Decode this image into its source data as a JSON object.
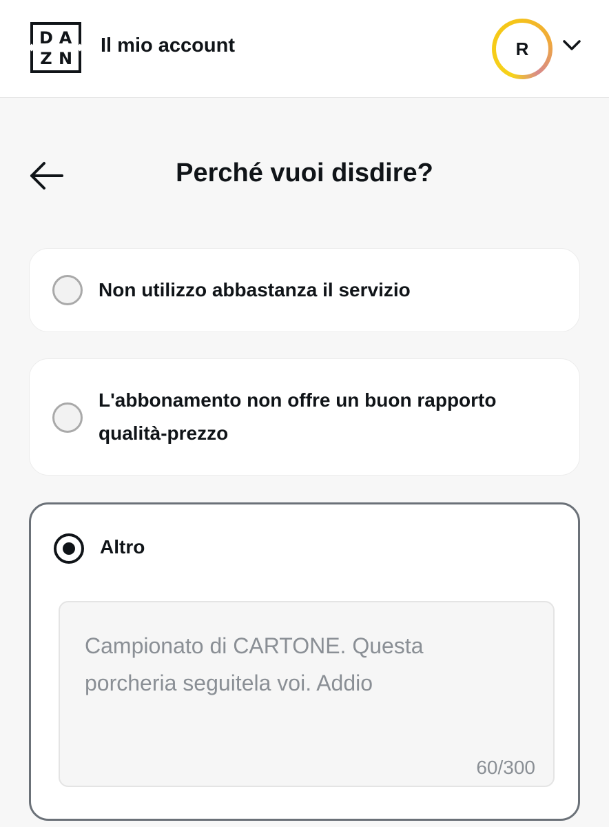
{
  "header": {
    "logo_letters": [
      "D",
      "A",
      "Z",
      "N"
    ],
    "title": "Il mio account",
    "avatar_initial": "R",
    "menu_icon": "chevron-down-icon"
  },
  "page": {
    "back_icon": "arrow-left-icon",
    "title": "Perché vuoi disdire?"
  },
  "options": [
    {
      "label": "Non utilizzo abbastanza il servizio",
      "selected": false
    },
    {
      "label_line1": "L'abbonamento non offre un buon rapporto",
      "label_line2": "qualità-prezzo",
      "selected": false
    },
    {
      "label": "Altro",
      "selected": true
    }
  ],
  "other_reason": {
    "text_line1": "Campionato di CARTONE. Questa",
    "text_line2": "porcheria seguitela voi. Addio",
    "counter": "60/300"
  },
  "colors": {
    "text": "#101418",
    "background": "#f7f7f7",
    "card": "#ffffff",
    "placeholder_text": "#8a8f95",
    "avatar_ring": "#f5c518"
  }
}
